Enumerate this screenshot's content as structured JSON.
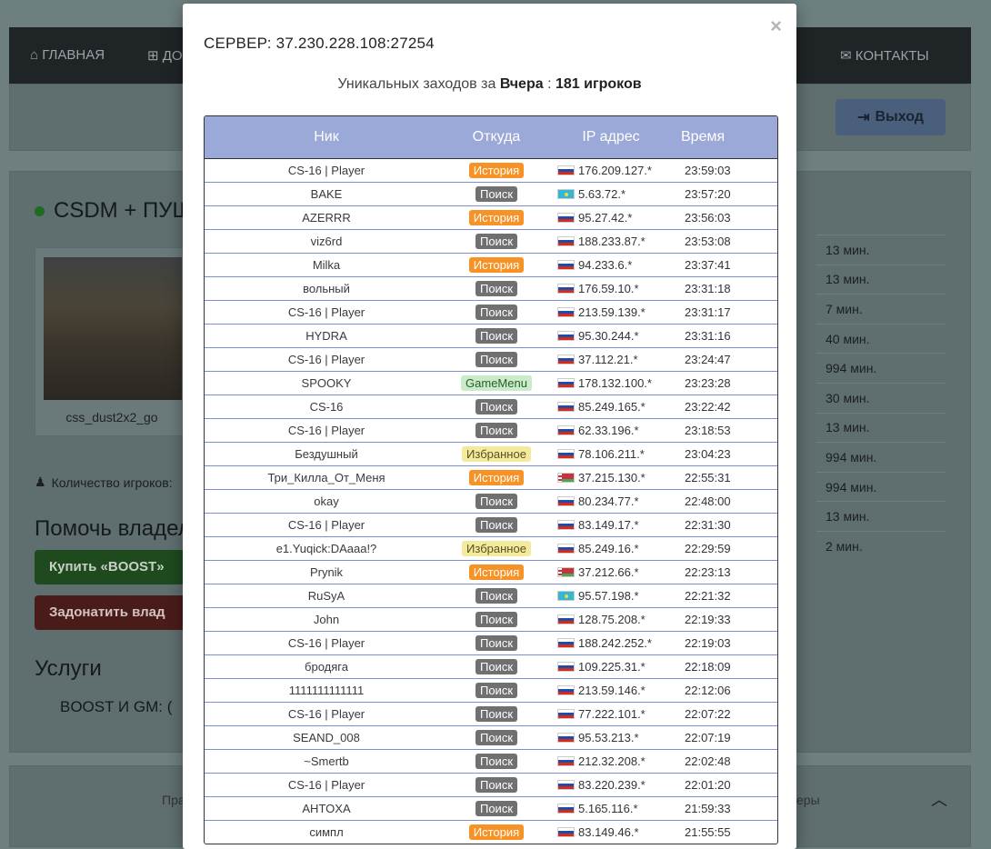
{
  "background": {
    "nav": [
      {
        "label": "ГЛАВНАЯ",
        "icon": "home-icon"
      },
      {
        "label": "ДО",
        "icon": "plus-square-icon"
      },
      {
        "label": "КОНТАКТЫ",
        "icon": "envelope-icon"
      }
    ],
    "logout_label": "Выход",
    "server_title": "CSDM + ПУШ",
    "map_name": "css_dust2x2_go",
    "players_label": "Количество игроков:",
    "help_title": "Помочь владел",
    "boost_button": "Купить «BOOST»",
    "donate_button": "Задонатить влад",
    "services_title": "Услуги",
    "services_item": "BOOST И GM:   (",
    "footer_left": "Пра",
    "footer_right": "еры",
    "side_times": [
      "13 мин.",
      "13 мин.",
      "7 мин.",
      "40 мин.",
      "994 мин.",
      "30 мин.",
      "13 мин.",
      "994 мин.",
      "994 мин.",
      "13 мин.",
      "2 мин."
    ]
  },
  "modal": {
    "close_label": "×",
    "title": "СЕРВЕР: 37.230.228.108:27254",
    "unique_prefix": "Уникальных заходов за",
    "unique_period": "Вчера",
    "unique_sep": ":",
    "unique_count": "181 игроков",
    "columns": {
      "nick": "Ник",
      "from": "Откуда",
      "ip": "IP адрес",
      "time": "Время"
    },
    "rows": [
      {
        "nick": "CS-16 | Player",
        "from": "История",
        "type": "hist",
        "flag": "ru",
        "ip": "176.209.127.*",
        "time": "23:59:03"
      },
      {
        "nick": "BAKE",
        "from": "Поиск",
        "type": "search",
        "flag": "kz",
        "ip": "5.63.72.*",
        "time": "23:57:20"
      },
      {
        "nick": "AZERRR",
        "from": "История",
        "type": "hist",
        "flag": "ru",
        "ip": "95.27.42.*",
        "time": "23:56:03"
      },
      {
        "nick": "viz6rd",
        "from": "Поиск",
        "type": "search",
        "flag": "ru",
        "ip": "188.233.87.*",
        "time": "23:53:08"
      },
      {
        "nick": "Milka",
        "from": "История",
        "type": "hist",
        "flag": "ru",
        "ip": "94.233.6.*",
        "time": "23:37:41"
      },
      {
        "nick": "вольный",
        "from": "Поиск",
        "type": "search",
        "flag": "ru",
        "ip": "176.59.10.*",
        "time": "23:31:18"
      },
      {
        "nick": "CS-16 | Player",
        "from": "Поиск",
        "type": "search",
        "flag": "ru",
        "ip": "213.59.139.*",
        "time": "23:31:17"
      },
      {
        "nick": "HYDRA",
        "from": "Поиск",
        "type": "search",
        "flag": "ru",
        "ip": "95.30.244.*",
        "time": "23:31:16"
      },
      {
        "nick": "CS-16 | Player",
        "from": "Поиск",
        "type": "search",
        "flag": "ru",
        "ip": "37.112.21.*",
        "time": "23:24:47"
      },
      {
        "nick": "SPOOKY",
        "from": "GameMenu",
        "type": "gm",
        "flag": "ru",
        "ip": "178.132.100.*",
        "time": "23:23:28"
      },
      {
        "nick": "CS-16",
        "from": "Поиск",
        "type": "search",
        "flag": "ru",
        "ip": "85.249.165.*",
        "time": "23:22:42"
      },
      {
        "nick": "CS-16 | Player",
        "from": "Поиск",
        "type": "search",
        "flag": "ru",
        "ip": "62.33.196.*",
        "time": "23:18:53"
      },
      {
        "nick": "Бездушный",
        "from": "Избранное",
        "type": "fav",
        "flag": "ru",
        "ip": "78.106.211.*",
        "time": "23:04:23"
      },
      {
        "nick": "Три_Килла_От_Меня",
        "from": "История",
        "type": "hist",
        "flag": "by",
        "ip": "37.215.130.*",
        "time": "22:55:31"
      },
      {
        "nick": "okay",
        "from": "Поиск",
        "type": "search",
        "flag": "ru",
        "ip": "80.234.77.*",
        "time": "22:48:00"
      },
      {
        "nick": "CS-16 | Player",
        "from": "Поиск",
        "type": "search",
        "flag": "ru",
        "ip": "83.149.17.*",
        "time": "22:31:30"
      },
      {
        "nick": "e1.Yuqick:DAaaa!?",
        "from": "Избранное",
        "type": "fav",
        "flag": "ru",
        "ip": "85.249.16.*",
        "time": "22:29:59"
      },
      {
        "nick": "Prynik",
        "from": "История",
        "type": "hist",
        "flag": "by",
        "ip": "37.212.66.*",
        "time": "22:23:13"
      },
      {
        "nick": "RuSyA",
        "from": "Поиск",
        "type": "search",
        "flag": "kz",
        "ip": "95.57.198.*",
        "time": "22:21:32"
      },
      {
        "nick": "John",
        "from": "Поиск",
        "type": "search",
        "flag": "ru",
        "ip": "128.75.208.*",
        "time": "22:19:33"
      },
      {
        "nick": "CS-16 | Player",
        "from": "Поиск",
        "type": "search",
        "flag": "ru",
        "ip": "188.242.252.*",
        "time": "22:19:03"
      },
      {
        "nick": "бродяга",
        "from": "Поиск",
        "type": "search",
        "flag": "ru",
        "ip": "109.225.31.*",
        "time": "22:18:09"
      },
      {
        "nick": "1111111111111",
        "from": "Поиск",
        "type": "search",
        "flag": "ru",
        "ip": "213.59.146.*",
        "time": "22:12:06"
      },
      {
        "nick": "CS-16 | Player",
        "from": "Поиск",
        "type": "search",
        "flag": "ru",
        "ip": "77.222.101.*",
        "time": "22:07:22"
      },
      {
        "nick": "SEAND_008",
        "from": "Поиск",
        "type": "search",
        "flag": "ru",
        "ip": "95.53.213.*",
        "time": "22:07:19"
      },
      {
        "nick": "~Smertb",
        "from": "Поиск",
        "type": "search",
        "flag": "ru",
        "ip": "212.32.208.*",
        "time": "22:02:48"
      },
      {
        "nick": "CS-16 | Player",
        "from": "Поиск",
        "type": "search",
        "flag": "ru",
        "ip": "83.220.239.*",
        "time": "22:01:20"
      },
      {
        "nick": "AHTOXA",
        "from": "Поиск",
        "type": "search",
        "flag": "ru",
        "ip": "5.165.116.*",
        "time": "21:59:33"
      },
      {
        "nick": "симпл",
        "from": "История",
        "type": "hist",
        "flag": "ru",
        "ip": "83.149.46.*",
        "time": "21:55:55"
      }
    ]
  }
}
